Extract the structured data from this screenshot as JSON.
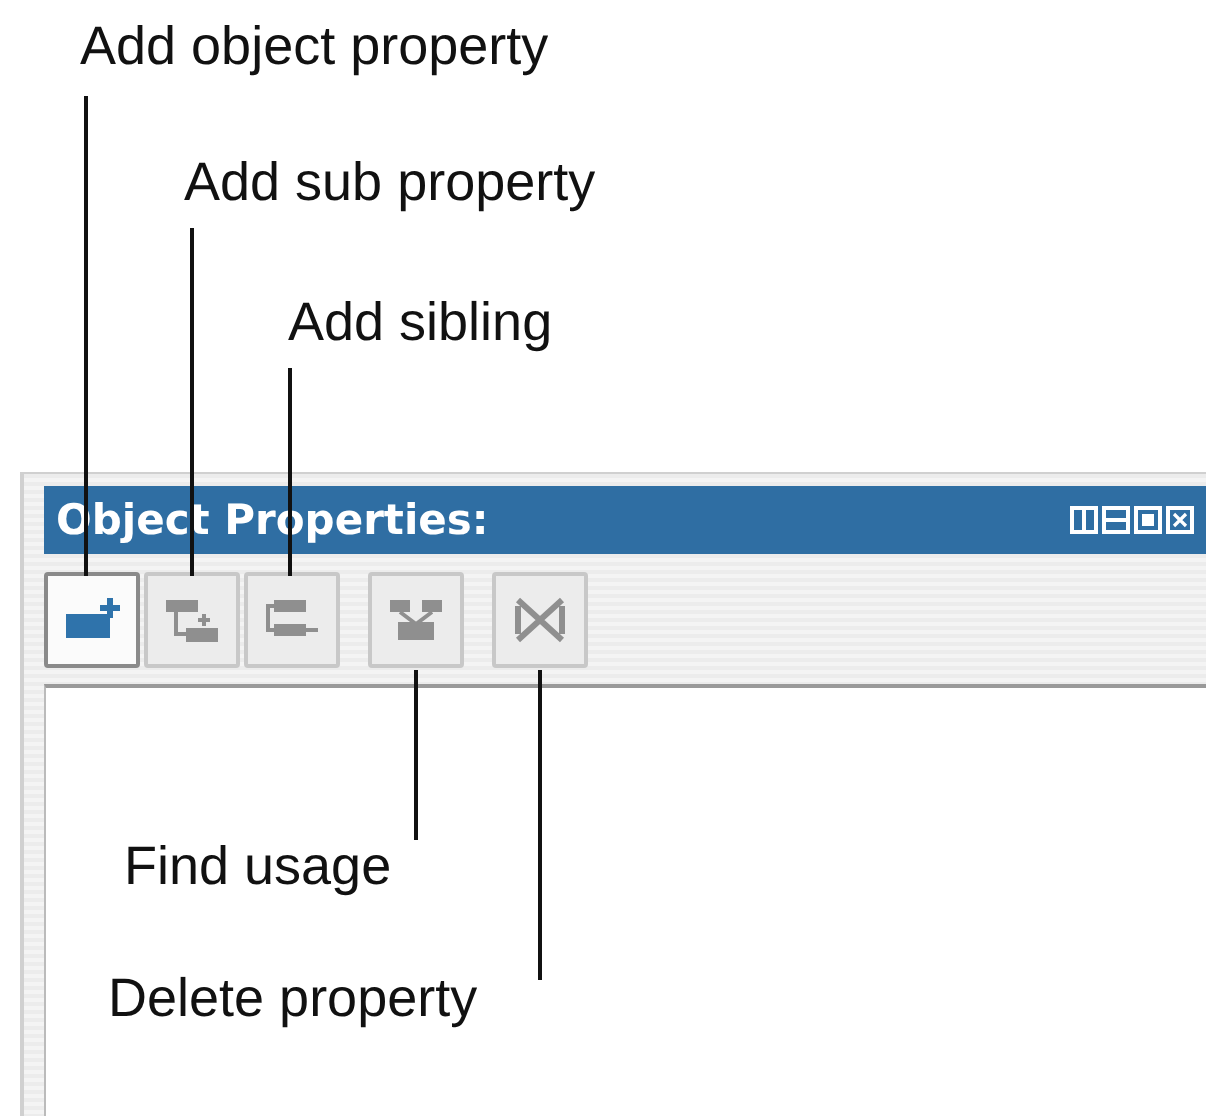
{
  "panel": {
    "title": "Object Properties:"
  },
  "toolbar": [
    {
      "selected": true,
      "disabled": false,
      "callout": "Add object property"
    },
    {
      "selected": false,
      "disabled": true,
      "callout": "Add sub property"
    },
    {
      "selected": false,
      "disabled": true,
      "callout": "Add sibling"
    },
    {
      "selected": false,
      "disabled": true,
      "callout": "Find usage"
    },
    {
      "selected": false,
      "disabled": true,
      "callout": "Delete property"
    }
  ]
}
